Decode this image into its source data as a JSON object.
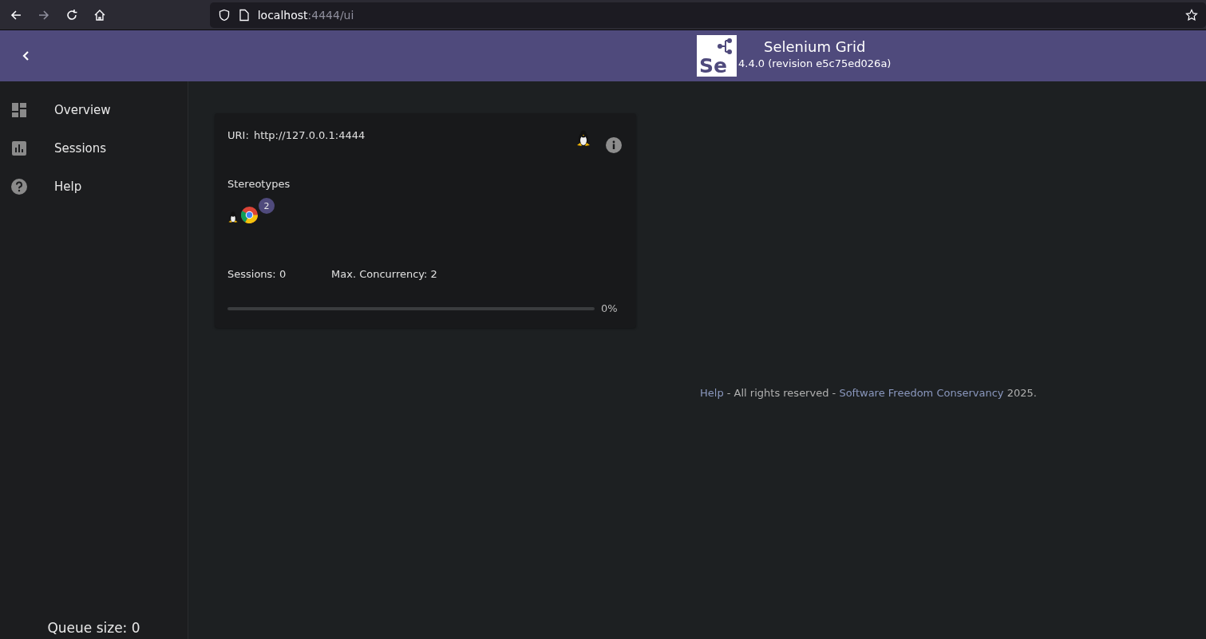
{
  "browser": {
    "url_host": "localhost",
    "url_path": ":4444/ui"
  },
  "header": {
    "logo_text": "Se",
    "title": "Selenium Grid",
    "version": "4.4.0 (revision e5c75ed026a)"
  },
  "sidebar": {
    "items": [
      {
        "kind": "dashboard",
        "label": "Overview"
      },
      {
        "kind": "chart",
        "label": "Sessions"
      },
      {
        "kind": "help",
        "label": "Help"
      }
    ],
    "queue_size": "Queue size: 0"
  },
  "node": {
    "uri_label": "URI:",
    "uri": "http://127.0.0.1:4444",
    "stereotypes_label": "Stereotypes",
    "stereotype_count": "2",
    "sessions": "Sessions: 0",
    "max_concurrency": "Max. Concurrency: 2",
    "level": 0,
    "percent": "0%"
  },
  "footer": {
    "help_link": "Help",
    "middle": " - All rights reserved - ",
    "org_link": "Software Freedom Conservancy",
    "end": " 2025."
  }
}
